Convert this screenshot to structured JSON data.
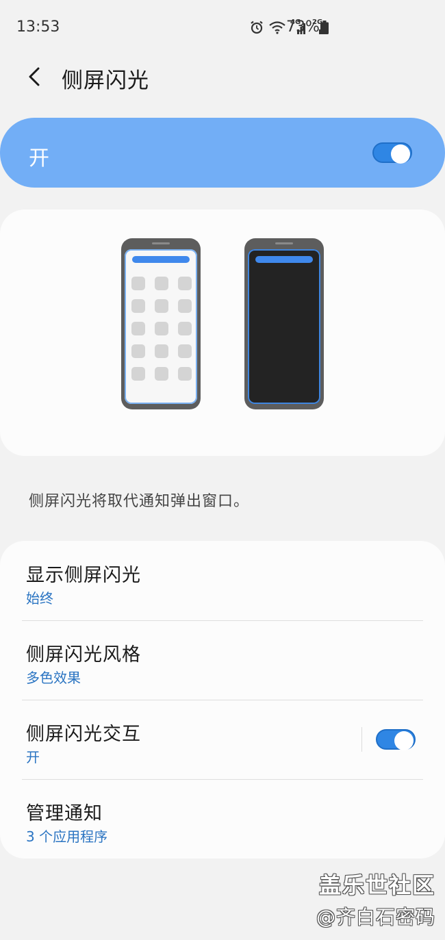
{
  "status_bar": {
    "time": "13:53",
    "icons": [
      "alarm-icon",
      "wifi-icon",
      "signal-4g-icon",
      "signal-2g-icon",
      "battery-icon"
    ],
    "network_4g": "4G",
    "network_2g": "2G",
    "battery": "73%"
  },
  "header": {
    "title": "侧屏闪光"
  },
  "master_switch": {
    "label": "开",
    "on": true
  },
  "description": "侧屏闪光将取代通知弹出窗口。",
  "settings": {
    "items": [
      {
        "title": "显示侧屏闪光",
        "subtitle": "始终"
      },
      {
        "title": "侧屏闪光风格",
        "subtitle": "多色效果"
      },
      {
        "title": "侧屏闪光交互",
        "subtitle": "开",
        "toggle_on": true
      },
      {
        "title": "管理通知",
        "subtitle": "3 个应用程序"
      }
    ]
  },
  "colors": {
    "accent": "#2f86e4",
    "master_bar": "#72aef6",
    "subtitle": "#2a74c2",
    "background": "#f2f2f2"
  },
  "watermark": {
    "line1": "盖乐世社区",
    "line2": "@齐白石密码"
  }
}
